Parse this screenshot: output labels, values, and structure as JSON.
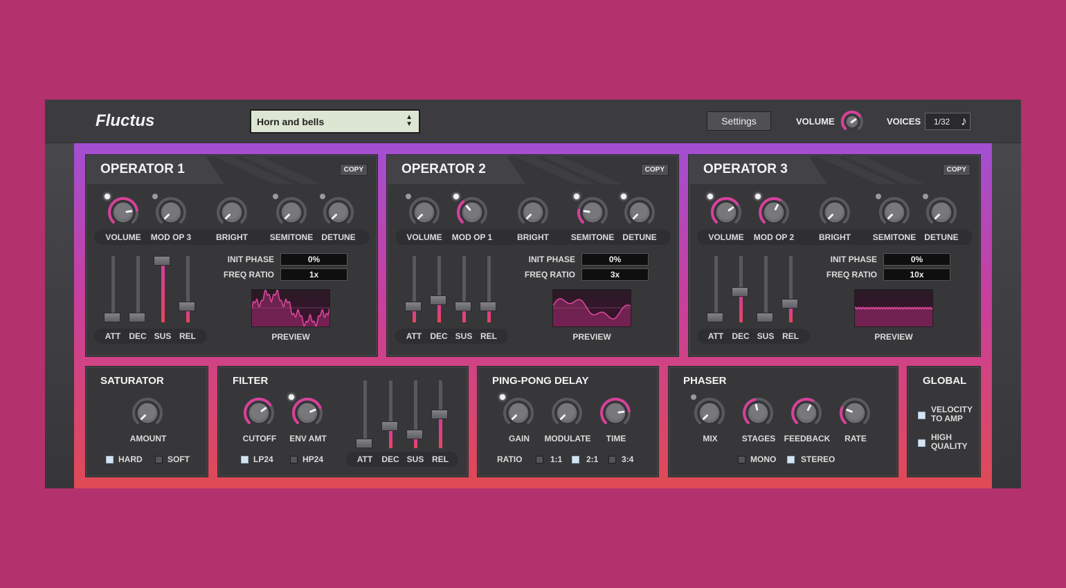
{
  "app": {
    "title": "Fluctus"
  },
  "header": {
    "preset": "Horn and bells",
    "settings_label": "Settings",
    "volume_label": "VOLUME",
    "voices_label": "VOICES",
    "voices_value": "1/32",
    "voices_icon": "music-note-icon"
  },
  "colors": {
    "accent_pink": "#d33ba0",
    "accent_red": "#e8455f",
    "accent_purple": "#a24fd3",
    "background": "#b3316c"
  },
  "operators": [
    {
      "title": "OPERATOR 1",
      "copy_label": "COPY",
      "knobs": [
        {
          "label": "VOLUME",
          "has_dot": true,
          "dot_on": true,
          "arc": 0.8
        },
        {
          "label": "MOD OP 3",
          "has_dot": true,
          "dot_on": false,
          "arc": 0
        },
        {
          "label": "BRIGHT",
          "has_dot": false,
          "dot_on": false,
          "arc": 0
        },
        {
          "label": "SEMITONE",
          "has_dot": true,
          "dot_on": false,
          "arc": 0
        },
        {
          "label": "DETUNE",
          "has_dot": true,
          "dot_on": false,
          "arc": 0
        }
      ],
      "faders": [
        {
          "label": "ATT",
          "level": 0.0
        },
        {
          "label": "DEC",
          "level": 0.0
        },
        {
          "label": "SUS",
          "level": 1.0
        },
        {
          "label": "REL",
          "level": 0.2
        }
      ],
      "init_phase_label": "INIT PHASE",
      "init_phase": "0%",
      "freq_ratio_label": "FREQ RATIO",
      "freq_ratio": "1x",
      "preview_label": "PREVIEW",
      "wave": "noisy"
    },
    {
      "title": "OPERATOR 2",
      "copy_label": "COPY",
      "knobs": [
        {
          "label": "VOLUME",
          "has_dot": true,
          "dot_on": false,
          "arc": 0
        },
        {
          "label": "MOD OP 1",
          "has_dot": true,
          "dot_on": true,
          "arc": 0.35
        },
        {
          "label": "BRIGHT",
          "has_dot": false,
          "dot_on": false,
          "arc": 0
        },
        {
          "label": "SEMITONE",
          "has_dot": true,
          "dot_on": true,
          "arc": 0.2
        },
        {
          "label": "DETUNE",
          "has_dot": true,
          "dot_on": true,
          "arc": 0
        }
      ],
      "faders": [
        {
          "label": "ATT",
          "level": 0.2
        },
        {
          "label": "DEC",
          "level": 0.3
        },
        {
          "label": "SUS",
          "level": 0.2
        },
        {
          "label": "REL",
          "level": 0.2
        }
      ],
      "init_phase_label": "INIT PHASE",
      "init_phase": "0%",
      "freq_ratio_label": "FREQ RATIO",
      "freq_ratio": "3x",
      "preview_label": "PREVIEW",
      "wave": "smooth"
    },
    {
      "title": "OPERATOR 3",
      "copy_label": "COPY",
      "knobs": [
        {
          "label": "VOLUME",
          "has_dot": true,
          "dot_on": true,
          "arc": 0.7
        },
        {
          "label": "MOD OP 2",
          "has_dot": true,
          "dot_on": true,
          "arc": 0.6
        },
        {
          "label": "BRIGHT",
          "has_dot": false,
          "dot_on": false,
          "arc": 0
        },
        {
          "label": "SEMITONE",
          "has_dot": true,
          "dot_on": false,
          "arc": 0
        },
        {
          "label": "DETUNE",
          "has_dot": true,
          "dot_on": false,
          "arc": 0
        }
      ],
      "faders": [
        {
          "label": "ATT",
          "level": 0.0
        },
        {
          "label": "DEC",
          "level": 0.45
        },
        {
          "label": "SUS",
          "level": 0.0
        },
        {
          "label": "REL",
          "level": 0.25
        }
      ],
      "init_phase_label": "INIT PHASE",
      "init_phase": "0%",
      "freq_ratio_label": "FREQ RATIO",
      "freq_ratio": "10x",
      "preview_label": "PREVIEW",
      "wave": "flat"
    }
  ],
  "saturator": {
    "title": "SATURATOR",
    "amount_label": "AMOUNT",
    "hard_label": "HARD",
    "hard_on": true,
    "soft_label": "SOFT",
    "soft_on": false
  },
  "filter": {
    "title": "FILTER",
    "cutoff_label": "CUTOFF",
    "env_amt_label": "ENV AMT",
    "lp24_label": "LP24",
    "lp24_on": true,
    "hp24_label": "HP24",
    "hp24_on": false,
    "faders": [
      {
        "label": "ATT",
        "level": 0.0
      },
      {
        "label": "DEC",
        "level": 0.3
      },
      {
        "label": "SUS",
        "level": 0.15
      },
      {
        "label": "REL",
        "level": 0.5
      }
    ]
  },
  "delay": {
    "title": "PING-PONG DELAY",
    "gain_label": "GAIN",
    "modulate_label": "MODULATE",
    "time_label": "TIME",
    "ratio_label": "RATIO",
    "ratios": [
      {
        "label": "1:1",
        "on": false
      },
      {
        "label": "2:1",
        "on": true
      },
      {
        "label": "3:4",
        "on": false
      }
    ]
  },
  "phaser": {
    "title": "PHASER",
    "mix_label": "MIX",
    "stages_label": "STAGES",
    "feedback_label": "FEEDBACK",
    "rate_label": "RATE",
    "mono_label": "MONO",
    "mono_on": false,
    "stereo_label": "STEREO",
    "stereo_on": true
  },
  "global": {
    "title": "GLOBAL",
    "velocity_line1": "VELOCITY",
    "velocity_line2": "TO AMP",
    "velocity_on": true,
    "hq_line1": "HIGH",
    "hq_line2": "QUALITY",
    "hq_on": true
  }
}
